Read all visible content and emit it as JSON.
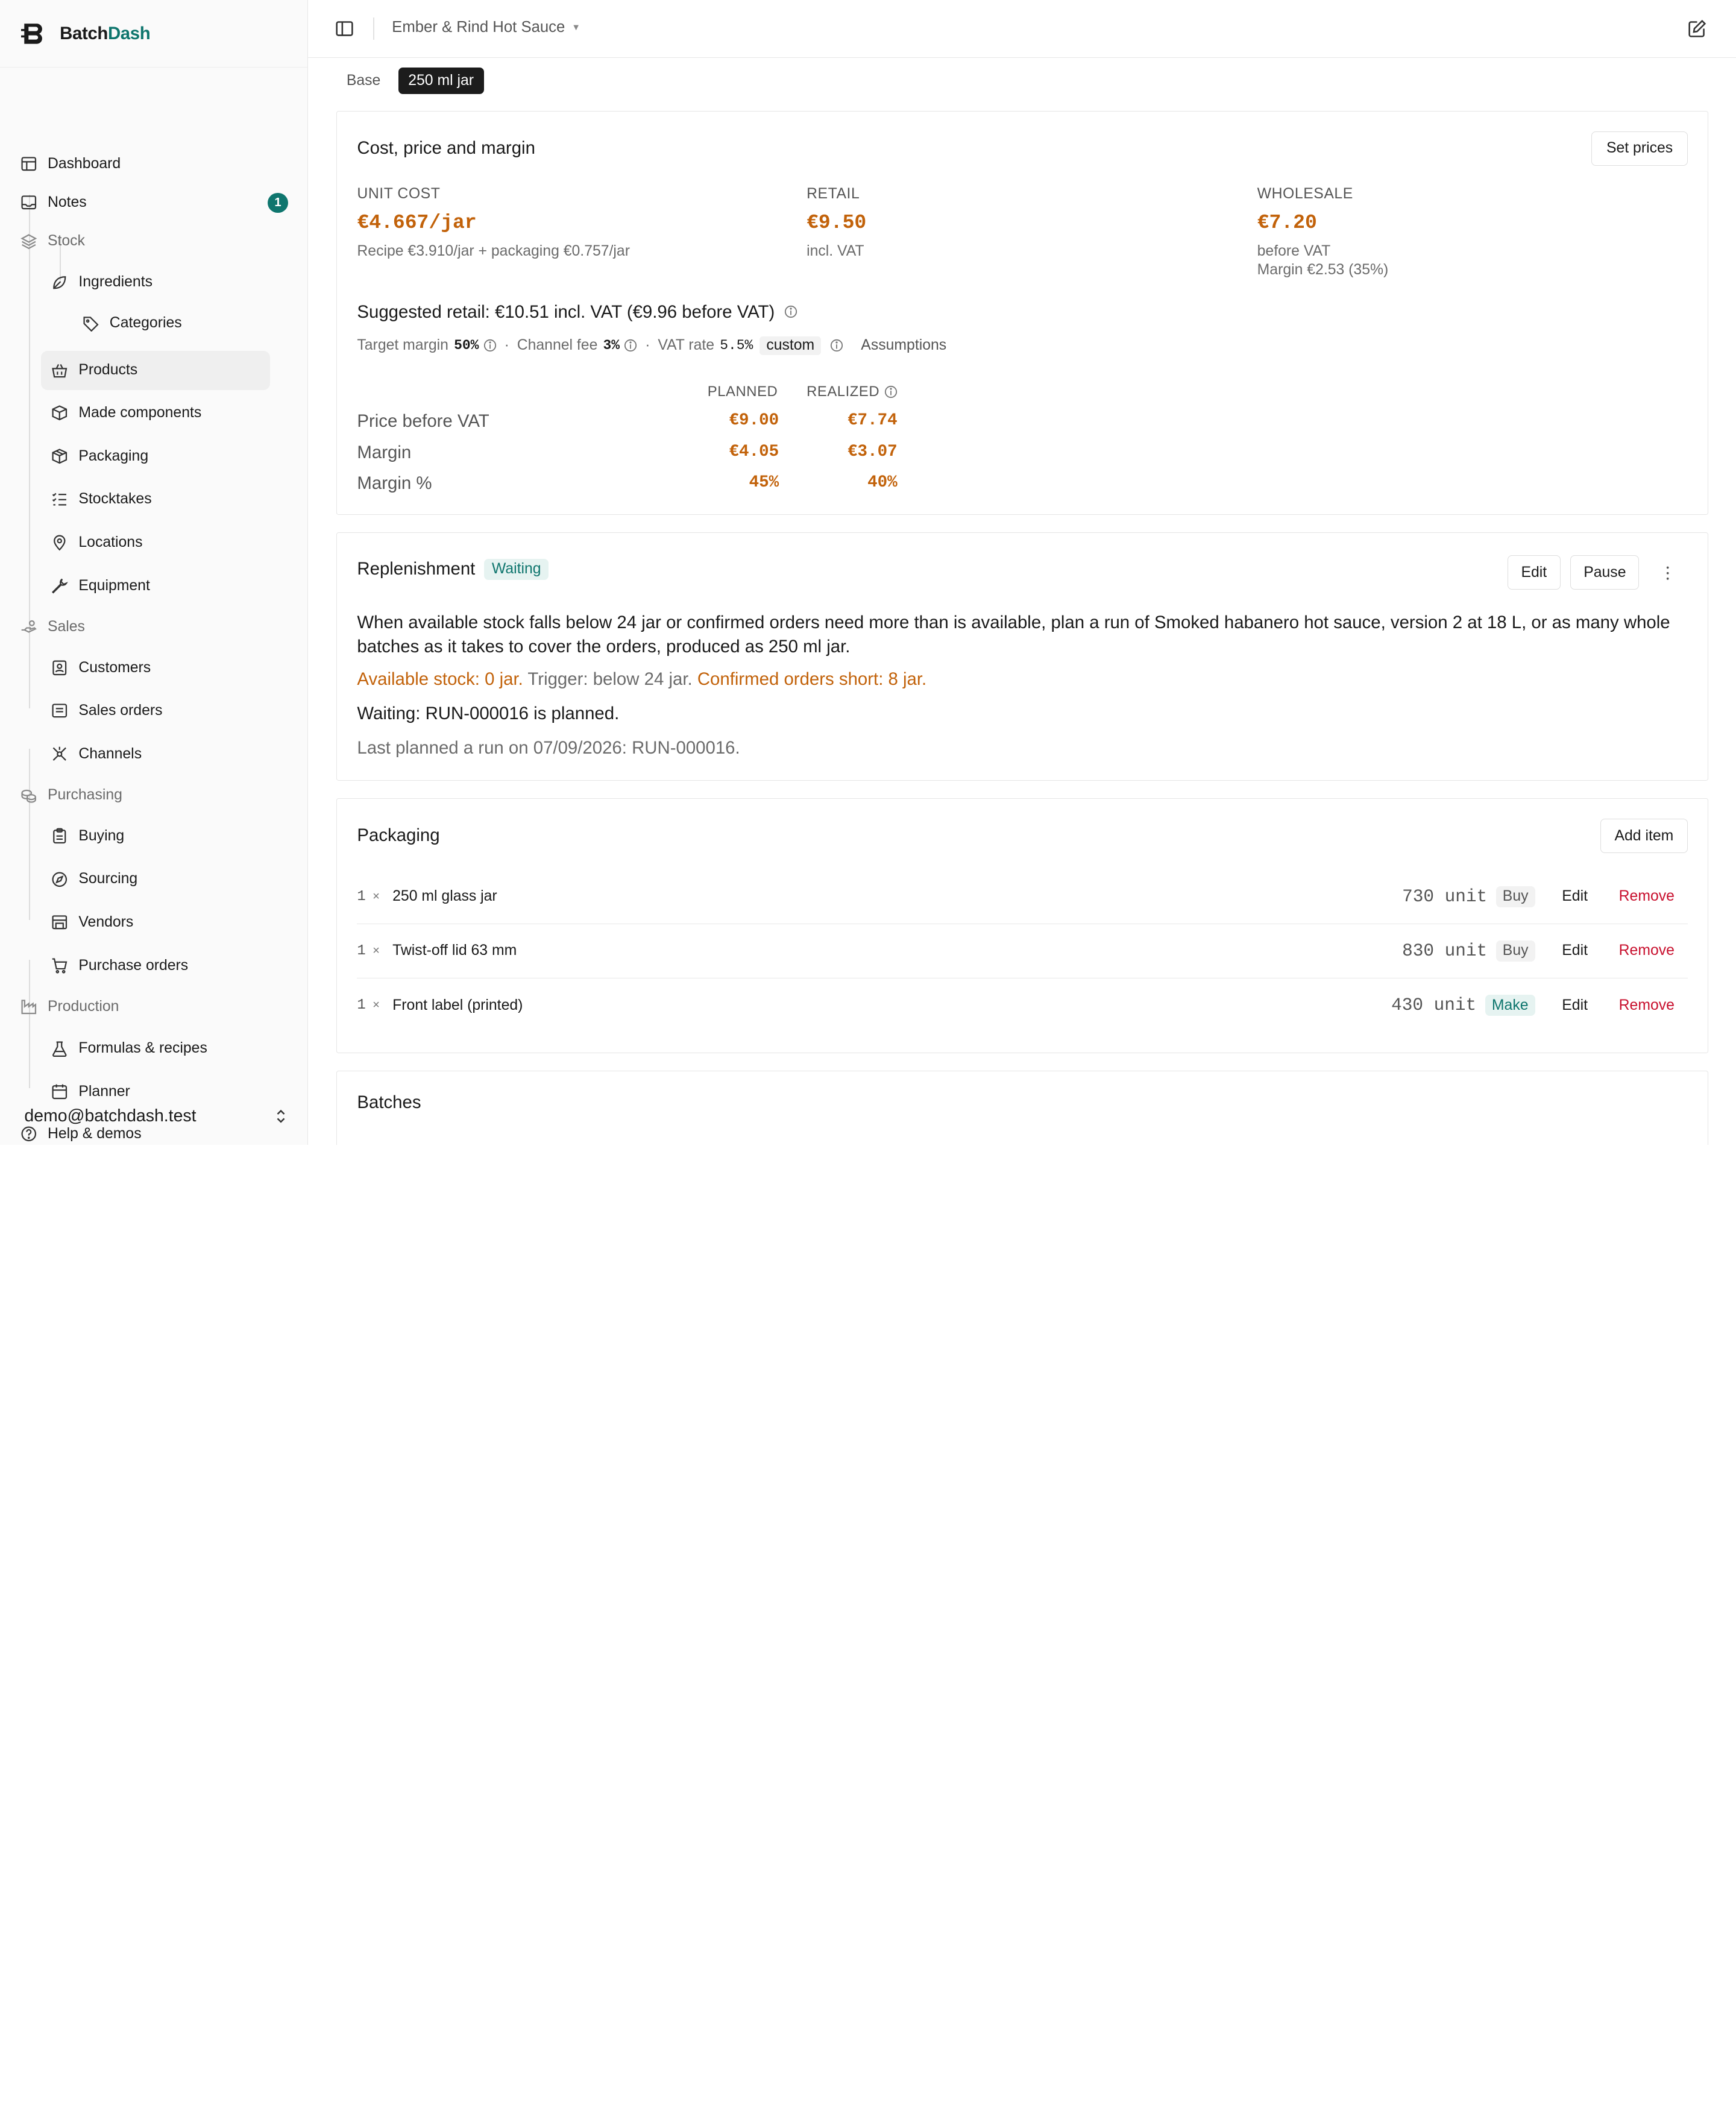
{
  "brand": {
    "name_part1": "Batch",
    "name_part2": "Dash"
  },
  "sidebar": {
    "items": [
      {
        "label": "Dashboard",
        "icon": "layout-icon"
      },
      {
        "label": "Notes",
        "icon": "inbox-icon",
        "badge": "1"
      },
      {
        "label": "Stock",
        "icon": "layers-icon",
        "group": true
      },
      {
        "label": "Ingredients",
        "icon": "leaf-icon"
      },
      {
        "label": "Categories",
        "icon": "tag-icon"
      },
      {
        "label": "Products",
        "icon": "basket-icon",
        "active": true
      },
      {
        "label": "Made components",
        "icon": "box-icon"
      },
      {
        "label": "Packaging",
        "icon": "package-icon"
      },
      {
        "label": "Stocktakes",
        "icon": "checklist-icon"
      },
      {
        "label": "Locations",
        "icon": "map-pin-icon"
      },
      {
        "label": "Equipment",
        "icon": "wrench-icon"
      },
      {
        "label": "Sales",
        "icon": "hand-coins-icon",
        "group": true
      },
      {
        "label": "Customers",
        "icon": "contact-icon"
      },
      {
        "label": "Sales orders",
        "icon": "receipt-icon"
      },
      {
        "label": "Channels",
        "icon": "network-icon"
      },
      {
        "label": "Purchasing",
        "icon": "coins-icon",
        "group": true
      },
      {
        "label": "Buying",
        "icon": "clipboard-icon"
      },
      {
        "label": "Sourcing",
        "icon": "compass-icon"
      },
      {
        "label": "Vendors",
        "icon": "store-icon"
      },
      {
        "label": "Purchase orders",
        "icon": "cart-icon"
      },
      {
        "label": "Production",
        "icon": "factory-icon",
        "group": true
      },
      {
        "label": "Formulas & recipes",
        "icon": "flask-icon"
      },
      {
        "label": "Planner",
        "icon": "calendar-icon"
      },
      {
        "label": "Help & demos",
        "icon": "help-circle-icon"
      }
    ],
    "user_email": "demo@batchdash.test"
  },
  "topbar": {
    "breadcrumb": "Ember & Rind Hot Sauce"
  },
  "tabs": [
    {
      "label": "Base"
    },
    {
      "label": "250 ml jar",
      "active": true
    }
  ],
  "pricing": {
    "title": "Cost, price and margin",
    "set_prices_label": "Set prices",
    "unit_cost": {
      "label": "UNIT COST",
      "value": "€4.667/jar",
      "sub": "Recipe €3.910/jar + packaging €0.757/jar"
    },
    "retail": {
      "label": "RETAIL",
      "value": "€9.50",
      "sub": "incl. VAT"
    },
    "wholesale": {
      "label": "WHOLESALE",
      "value": "€7.20",
      "sub": "before VAT",
      "sub2": "Margin €2.53 (35%)"
    },
    "suggested": "Suggested retail: €10.51 incl. VAT (€9.96 before VAT)",
    "assumptions": {
      "target_margin_label": "Target margin",
      "target_margin_value": "50%",
      "channel_fee_label": "Channel fee",
      "channel_fee_value": "3%",
      "vat_rate_label": "VAT rate",
      "vat_rate_value": "5.5%",
      "custom_label": "custom",
      "assumptions_link": "Assumptions",
      "separator": "·"
    },
    "table": {
      "col_planned": "PLANNED",
      "col_realized": "REALIZED",
      "rows": [
        {
          "label": "Price before VAT",
          "planned": "€9.00",
          "realized": "€7.74"
        },
        {
          "label": "Margin",
          "planned": "€4.05",
          "realized": "€3.07"
        },
        {
          "label": "Margin %",
          "planned": "45%",
          "realized": "40%"
        }
      ]
    }
  },
  "replenishment": {
    "title": "Replenishment",
    "status": "Waiting",
    "edit_label": "Edit",
    "pause_label": "Pause",
    "description": "When available stock falls below 24 jar or confirmed orders need more than is available, plan a run of Smoked habanero hot sauce, version 2 at 18 L, or as many whole batches as it takes to cover the orders, produced as 250 ml jar.",
    "available_stock": "Available stock: 0 jar.",
    "trigger": " Trigger: below 24 jar. ",
    "confirmed_short": "Confirmed orders short: 8 jar.",
    "waiting_text": "Waiting: RUN-000016 is planned.",
    "last_planned": "Last planned a run on 07/09/2026: RUN-000016."
  },
  "packaging": {
    "title": "Packaging",
    "add_item_label": "Add item",
    "qty_sep": "×",
    "edit_label": "Edit",
    "remove_label": "Remove",
    "items": [
      {
        "qty": "1",
        "name": "250 ml glass jar",
        "stock": "730 unit",
        "tag": "Buy"
      },
      {
        "qty": "1",
        "name": "Twist-off lid 63 mm",
        "stock": "830 unit",
        "tag": "Buy"
      },
      {
        "qty": "1",
        "name": "Front label (printed)",
        "stock": "430 unit",
        "tag": "Make"
      }
    ]
  },
  "batches": {
    "title": "Batches"
  },
  "colors": {
    "accent": "#0f766e",
    "orange": "#c2620a",
    "danger": "#c8102e"
  }
}
